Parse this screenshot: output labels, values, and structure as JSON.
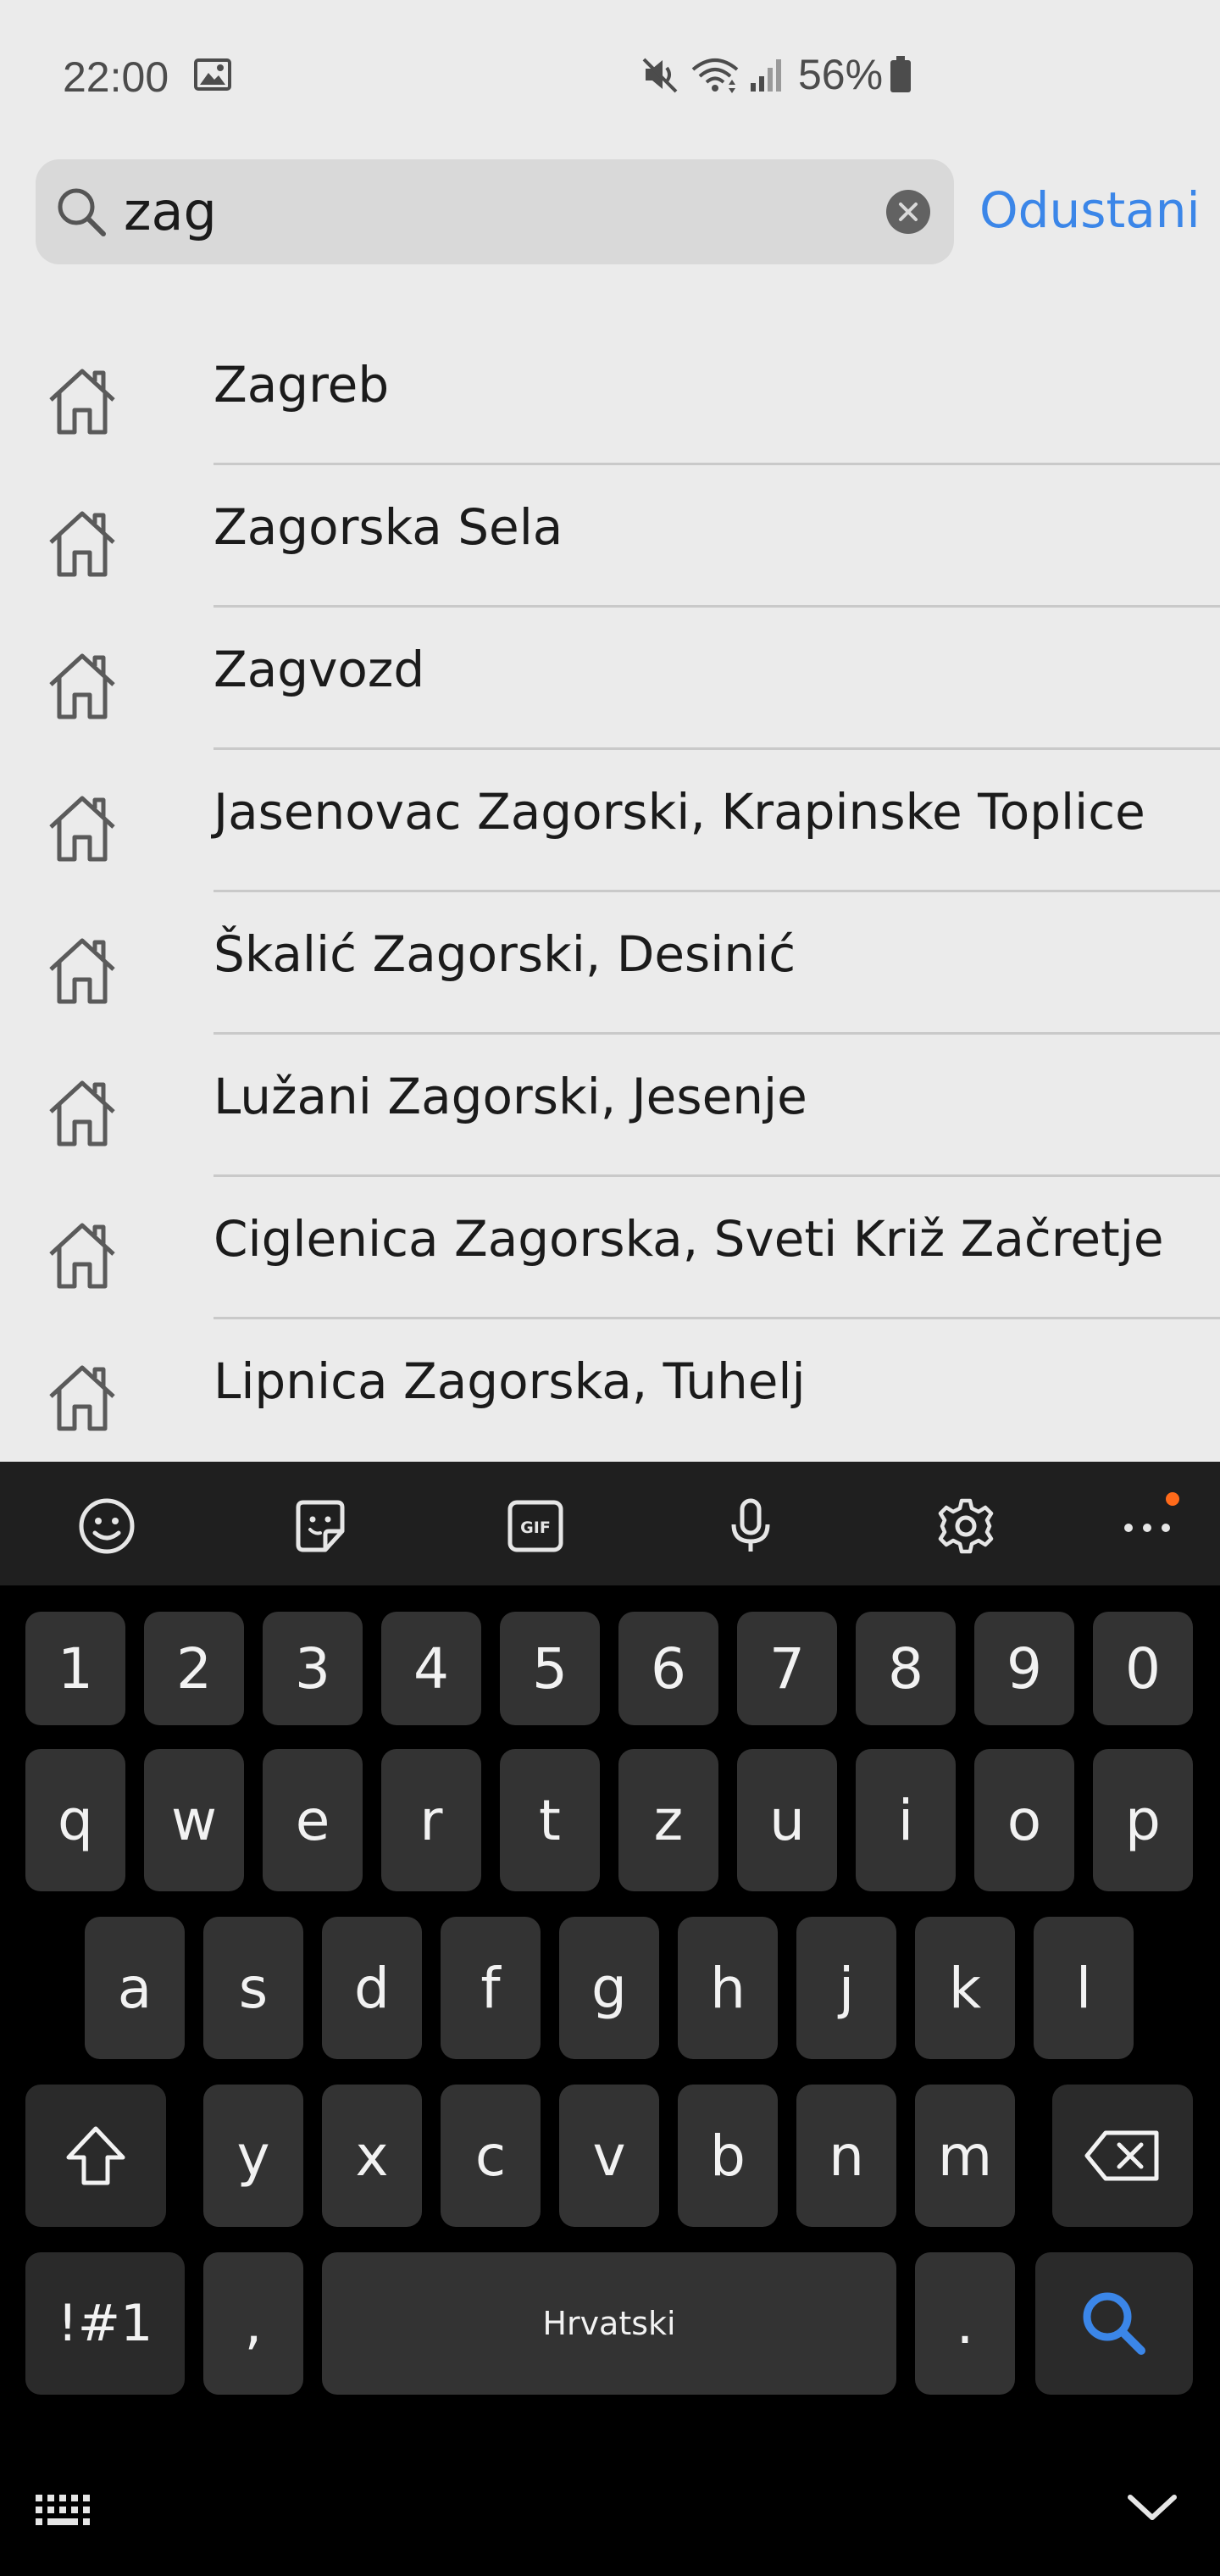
{
  "status_bar": {
    "time": "22:00",
    "battery_percent": "56%",
    "icons": [
      "image-icon",
      "mute-icon",
      "wifi-icon",
      "signal-icon",
      "battery-icon"
    ]
  },
  "search": {
    "value": "zag",
    "placeholder": "",
    "cancel_label": "Odustani"
  },
  "results": [
    {
      "label": "Zagreb",
      "icon": "home-icon"
    },
    {
      "label": "Zagorska Sela",
      "icon": "home-icon"
    },
    {
      "label": "Zagvozd",
      "icon": "home-icon"
    },
    {
      "label": "Jasenovac Zagorski, Krapinske Toplice",
      "icon": "home-icon"
    },
    {
      "label": "Škalić Zagorski, Desinić",
      "icon": "home-icon"
    },
    {
      "label": "Lužani Zagorski, Jesenje",
      "icon": "home-icon"
    },
    {
      "label": "Ciglenica Zagorska, Sveti Križ Začretje",
      "icon": "home-icon"
    },
    {
      "label": "Lipnica Zagorska, Tuhelj",
      "icon": "home-icon"
    }
  ],
  "keyboard": {
    "toolbar": [
      "emoji-icon",
      "sticker-icon",
      "gif-icon",
      "microphone-icon",
      "settings-icon",
      "more-icon"
    ],
    "gif_label": "GIF",
    "digits": [
      "1",
      "2",
      "3",
      "4",
      "5",
      "6",
      "7",
      "8",
      "9",
      "0"
    ],
    "row1": [
      "q",
      "w",
      "e",
      "r",
      "t",
      "z",
      "u",
      "i",
      "o",
      "p"
    ],
    "row2": [
      "a",
      "s",
      "d",
      "f",
      "g",
      "h",
      "j",
      "k",
      "l"
    ],
    "row3": [
      "y",
      "x",
      "c",
      "v",
      "b",
      "n",
      "m"
    ],
    "symbols_label": "!#1",
    "comma_label": ",",
    "space_label": "Hrvatski",
    "period_label": ".",
    "colors": {
      "accent": "#3b86e8",
      "key_bg": "#333333",
      "toolbar_bg": "#1f1f1f",
      "notification_dot": "#ff6a1a"
    }
  }
}
